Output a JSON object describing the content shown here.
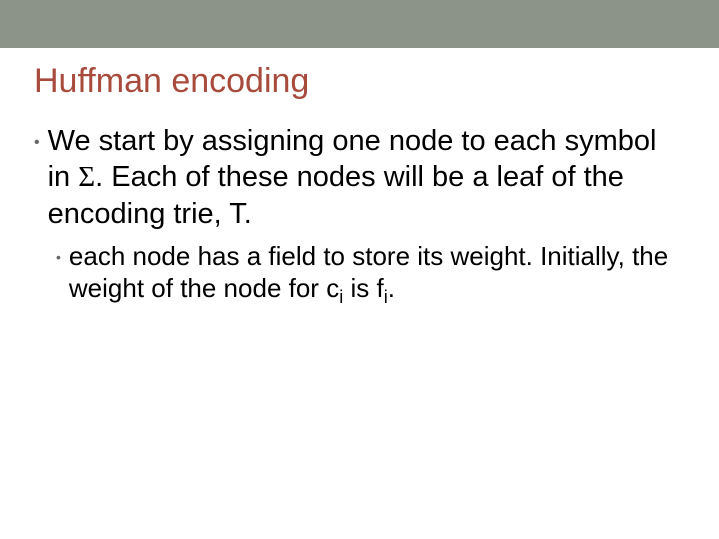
{
  "title": "Huffman encoding",
  "bullets": {
    "l1": {
      "pre": "We start by assigning one node to each symbol in ",
      "sigma": "Σ",
      "post": ".  Each of these nodes will be a leaf of the encoding trie, T."
    },
    "l2": {
      "pre": "each node has a field to store its weight.  Initially, the weight of the node for c",
      "sub1": "i",
      "mid": " is f",
      "sub2": "i",
      "post": "."
    }
  }
}
